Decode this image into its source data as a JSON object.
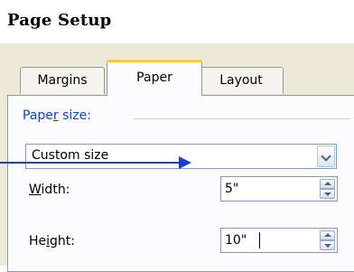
{
  "window": {
    "title": "Page Setup"
  },
  "tabs": [
    {
      "label": "Margins",
      "active": false
    },
    {
      "label": "Paper",
      "active": true
    },
    {
      "label": "Layout",
      "active": false
    }
  ],
  "paper_size": {
    "section_label_pre": "Pape",
    "section_label_acc": "r",
    "section_label_post": " size:",
    "selected": "Custom size"
  },
  "width": {
    "label_acc": "W",
    "label_rest": "idth:",
    "value": "5\""
  },
  "height": {
    "label_pre": "He",
    "label_acc": "i",
    "label_rest": "ght:",
    "value": "10\""
  },
  "colors": {
    "dialog_bg": "#ece9d8",
    "tab_highlight": "#ffc83c",
    "section_label": "#0046d5",
    "annotation_arrow": "#1a3fd6"
  },
  "icons": {
    "dropdown": "chevron-down-icon",
    "spin_up": "spin-up-icon",
    "spin_down": "spin-down-icon",
    "annotation": "arrow-right-icon"
  }
}
